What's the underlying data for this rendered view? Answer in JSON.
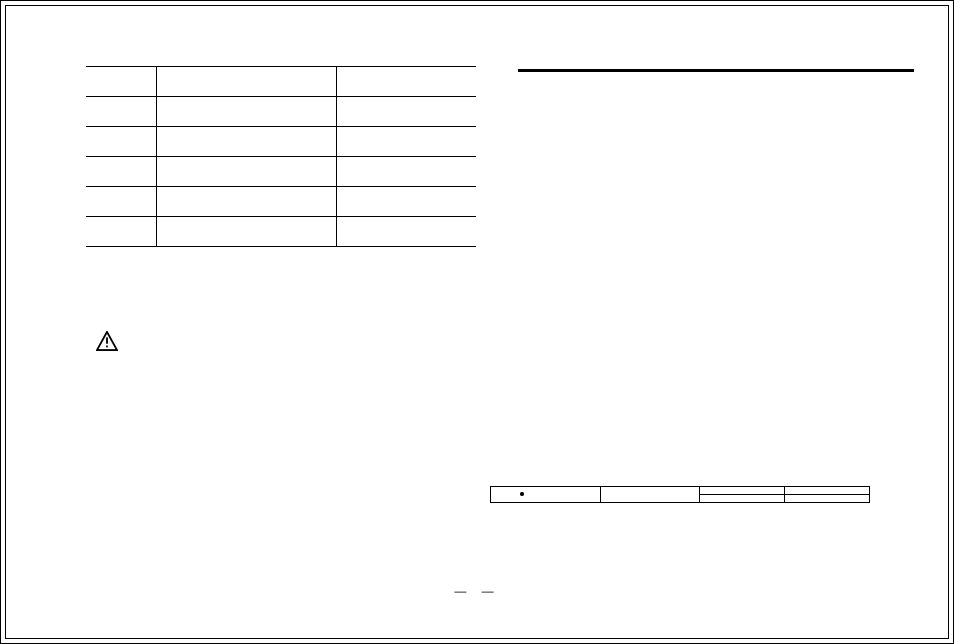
{
  "left_table": {
    "rows": [
      {
        "c1": "",
        "c2": "",
        "c3": ""
      },
      {
        "c1": "",
        "c2": "",
        "c3": ""
      },
      {
        "c1": "",
        "c2": "",
        "c3": ""
      },
      {
        "c1": "",
        "c2": "",
        "c3": ""
      },
      {
        "c1": "",
        "c2": "",
        "c3": ""
      },
      {
        "c1": "",
        "c2": "",
        "c3": ""
      }
    ]
  },
  "icons": {
    "warning": "warning-triangle-icon"
  },
  "small_table": {
    "row1": {
      "a": "",
      "b": "",
      "c": "",
      "d": ""
    },
    "row2": {
      "c": "",
      "d": ""
    }
  },
  "page_marker": "—    —"
}
